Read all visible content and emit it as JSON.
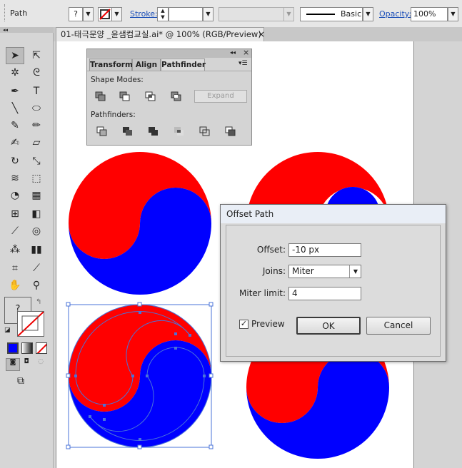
{
  "control_bar": {
    "object_type": "Path",
    "fill_question": "?",
    "stroke_label": "Stroke:",
    "brush_style": "Basic",
    "opacity_label": "Opacity:",
    "opacity_value": "100%"
  },
  "document_tab": {
    "title": "01-태극문양 _윤샘컴교실.ai* @ 100% (RGB/Preview)",
    "close": "×"
  },
  "toolbar": {
    "fill_stroke_unknown": "?"
  },
  "pathfinder_panel": {
    "tabs": [
      "Transform",
      "Align",
      "Pathfinder"
    ],
    "active_tab": "Pathfinder",
    "shape_modes_label": "Shape Modes:",
    "pathfinders_label": "Pathfinders:",
    "expand_label": "Expand",
    "collapse_glyph": "◂◂",
    "close_glyph": "×"
  },
  "offset_dialog": {
    "title": "Offset Path",
    "offset_label": "Offset:",
    "offset_value": "-10 px",
    "joins_label": "Joins:",
    "joins_value": "Miter",
    "miter_label": "Miter limit:",
    "miter_value": "4",
    "preview_label": "Preview",
    "preview_checked": true,
    "ok_label": "OK",
    "cancel_label": "Cancel"
  },
  "colors": {
    "red": "#ff0000",
    "blue": "#0000ff",
    "selection": "#4a73d8"
  }
}
